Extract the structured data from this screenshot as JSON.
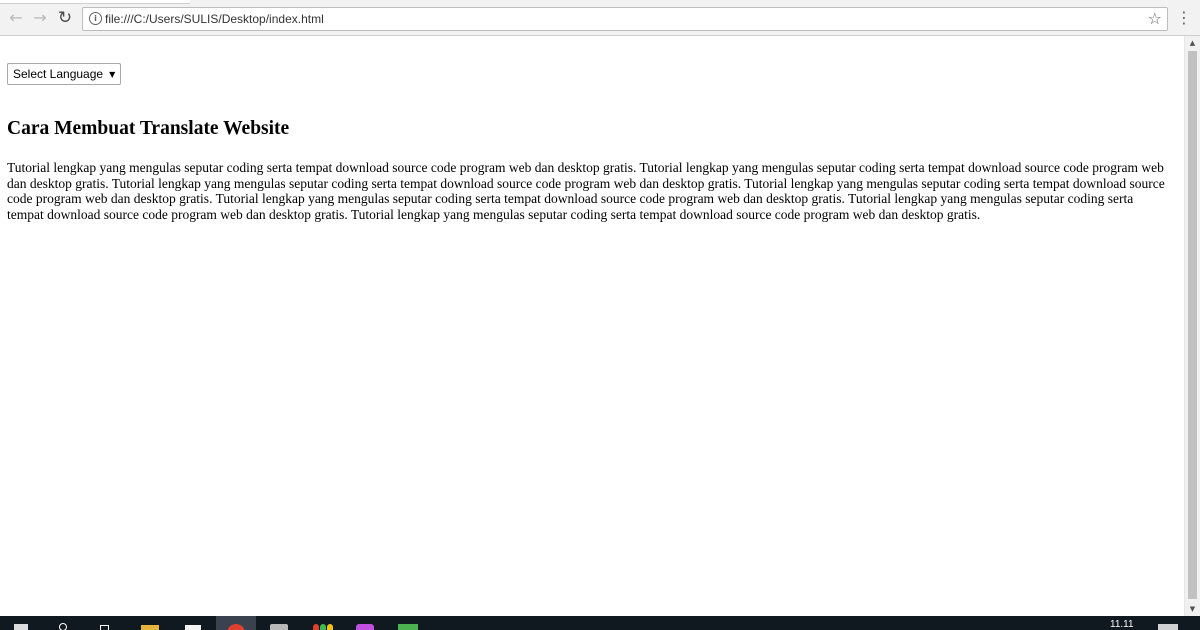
{
  "browser": {
    "url": "file:///C:/Users/SULIS/Desktop/index.html",
    "icons": {
      "back": "back-arrow-icon",
      "forward": "forward-arrow-icon",
      "reload": "reload-icon",
      "info": "info-icon",
      "bookmark": "star-icon",
      "menu": "more-vert-icon"
    }
  },
  "page": {
    "language_select": {
      "selected": "Select Language"
    },
    "title": "Cara Membuat Translate Website",
    "body": "Tutorial lengkap yang mengulas seputar coding serta tempat download source code program web dan desktop gratis. Tutorial lengkap yang mengulas seputar coding serta tempat download source code program web dan desktop gratis. Tutorial lengkap yang mengulas seputar coding serta tempat download source code program web dan desktop gratis. Tutorial lengkap yang mengulas seputar coding serta tempat download source code program web dan desktop gratis. Tutorial lengkap yang mengulas seputar coding serta tempat download source code program web dan desktop gratis. Tutorial lengkap yang mengulas seputar coding serta tempat download source code program web dan desktop gratis. Tutorial lengkap yang mengulas seputar coding serta tempat download source code program web dan desktop gratis."
  },
  "taskbar": {
    "clock": "11.11"
  },
  "colors": {
    "toolbar_bg": "#f2f2f2",
    "taskbar_bg": "#101820",
    "scrollbar_thumb": "#c1c1c1"
  }
}
